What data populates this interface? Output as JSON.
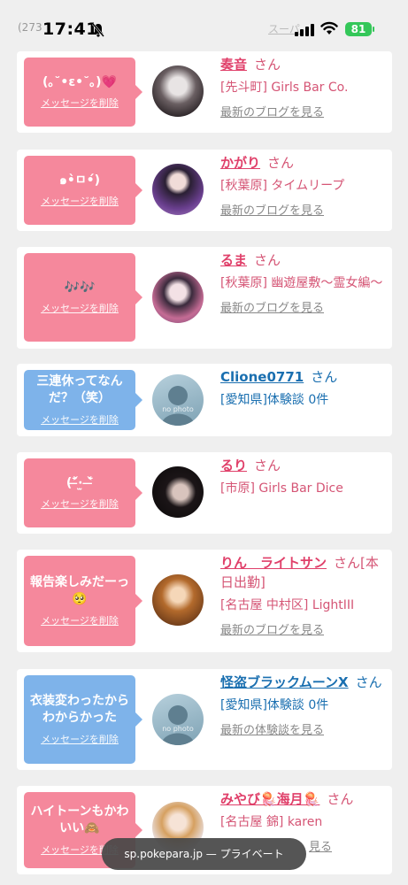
{
  "status_bar": {
    "counter_text": "(273",
    "time": "17:41",
    "top_link_text": "スーパ",
    "battery_level": "81"
  },
  "cards": [
    {
      "bubble_color": "pink",
      "message": "(｡˘•ε•˘｡)💗",
      "delete_label": "メッセージを削除",
      "name": "奏音",
      "san": "さん",
      "shop": "[先斗町] Girls Bar Co.",
      "link": "最新のブログを見る",
      "avatar_style": "photo-dark"
    },
    {
      "bubble_color": "pink",
      "message": "๑•̀ㅁ•́)",
      "delete_label": "メッセージを削除",
      "name": "かがり",
      "san": "さん",
      "shop": "[秋葉原] タイムリープ",
      "link": "最新のブログを見る",
      "avatar_style": "photo-purple"
    },
    {
      "bubble_color": "pink",
      "message": "🎶🎶",
      "delete_label": "メッセージを削除",
      "name": "るま",
      "san": "さん",
      "shop": "[秋葉原] 幽遊屋敷～霊女編～",
      "link": "最新のブログを見る",
      "avatar_style": "photo-pink"
    },
    {
      "bubble_color": "blue",
      "message": "三連休ってなんだ？（笑）",
      "delete_label": "メッセージを削除",
      "name": "Clione0771",
      "san": "さん",
      "shop": "[愛知県]体験談 0件",
      "link": "",
      "avatar_style": "nophoto",
      "nophoto_label": "no photo"
    },
    {
      "bubble_color": "pink",
      "message": "(˃̶᷄‧̫ ˂̶᷅",
      "delete_label": "メッセージを削除",
      "name": "るり",
      "san": "さん",
      "shop": "[市原] Girls Bar Dice",
      "link": "",
      "avatar_style": "photo-black"
    },
    {
      "bubble_color": "pink",
      "message": "報告楽しみだーっ🥺",
      "delete_label": "メッセージを削除",
      "name": "りん　ライトサン",
      "san": "さん[本日出勤]",
      "shop": "[名古屋 中村区] LightIII",
      "link": "最新のブログを見る",
      "avatar_style": "photo-gold"
    },
    {
      "bubble_color": "pink",
      "message": "衣装変わったからわからかった",
      "delete_label": "メッセージを削除",
      "name": "怪盗ブラックムーンX",
      "san": "さん",
      "shop": "[愛知県]体験談 0件",
      "link": "最新の体験談を見る",
      "avatar_style": "nophoto",
      "nophoto_label": "no photo"
    },
    {
      "bubble_color": "pink",
      "message": "ハイトーンもかわいい🙈",
      "delete_label": "メッセージを削除",
      "name": "みやび🪼海月🪼",
      "san": "さん",
      "shop": "[名古屋 錦] karen",
      "link": "見る",
      "avatar_style": "photo-light"
    }
  ],
  "url_bar": {
    "text": "sp.pokepara.jp — プライベート"
  },
  "colors": {
    "pink_bubble": "#f5889c",
    "blue_bubble": "#7eb3ea",
    "pink_text": "#d55575",
    "blue_text": "#1a6fb0"
  }
}
